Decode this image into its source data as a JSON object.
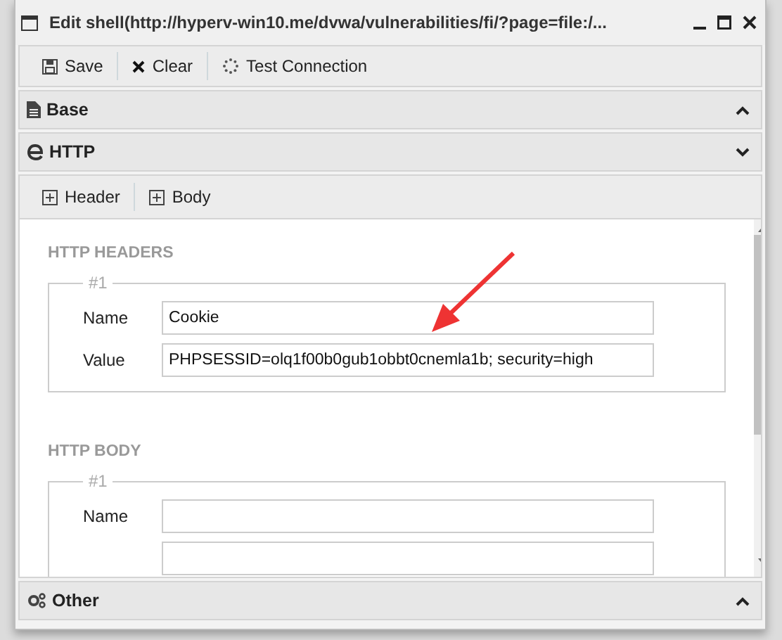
{
  "window": {
    "title": "Edit shell(http://hyperv-win10.me/dvwa/vulnerabilities/fi/?page=file:/..."
  },
  "toolbar": [
    {
      "kind": "save",
      "label": "Save"
    },
    {
      "kind": "clear",
      "label": "Clear"
    },
    {
      "kind": "test",
      "label": "Test Connection"
    }
  ],
  "sections": [
    {
      "kind": "base",
      "title": "Base",
      "expanded": false
    },
    {
      "kind": "http",
      "title": "HTTP",
      "expanded": true,
      "sub_toolbar": [
        "Header",
        "Body"
      ],
      "groups": [
        {
          "heading": "HTTP HEADERS",
          "entries": [
            {
              "number": "#1",
              "fields": [
                {
                  "kind": "text",
                  "label": "Name",
                  "value": "Cookie"
                },
                {
                  "kind": "text",
                  "label": "Value",
                  "value": "PHPSESSID=olq1f00b0gub1obbt0cnemla1b; security=high"
                }
              ]
            }
          ]
        },
        {
          "heading": "HTTP BODY",
          "entries": [
            {
              "number": "#1",
              "fields": [
                {
                  "kind": "text",
                  "label": "Name"
                },
                {
                  "kind": "text"
                }
              ]
            }
          ]
        }
      ]
    },
    {
      "kind": "other",
      "title": "Other",
      "expanded": false
    }
  ]
}
